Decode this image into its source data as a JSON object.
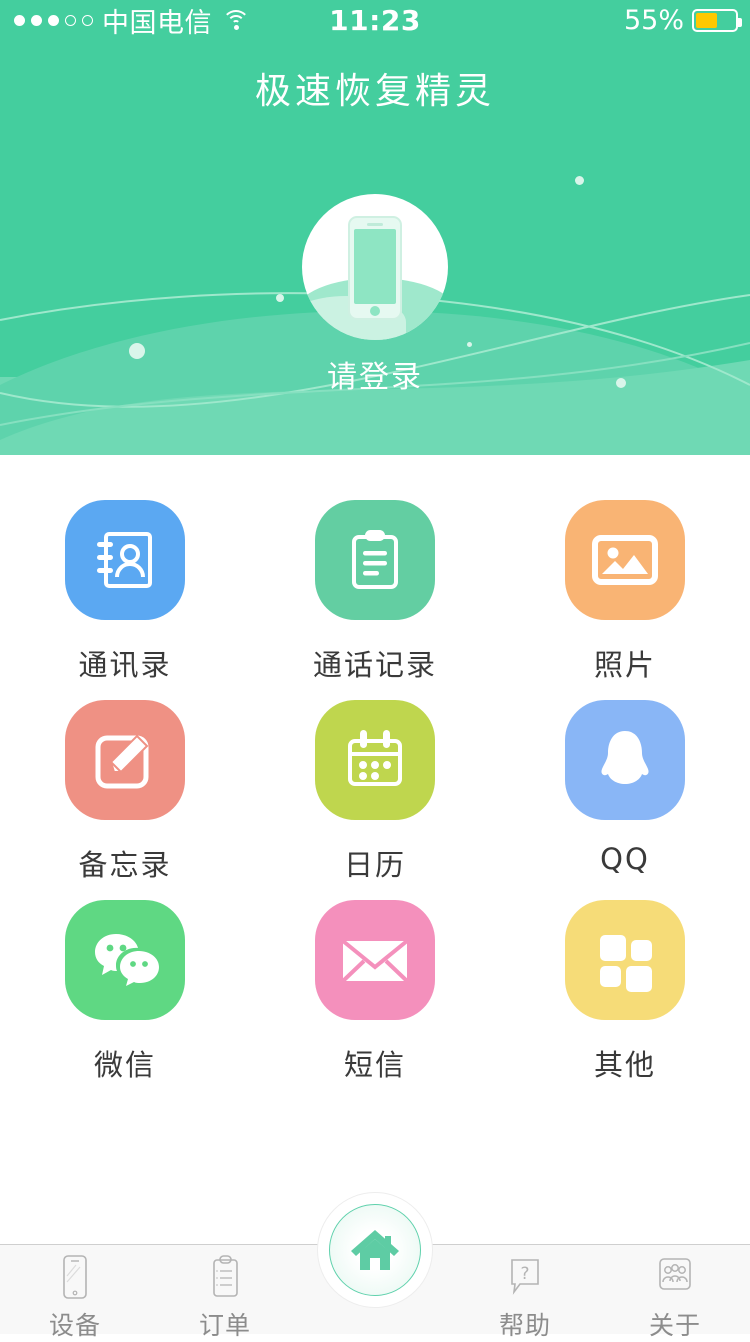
{
  "status_bar": {
    "signal_dots_total": 5,
    "signal_dots_filled": 3,
    "carrier": "中国电信",
    "wifi_icon": "wifi-icon",
    "time": "11:23",
    "battery_percent_label": "55%",
    "battery_level": 55,
    "battery_color": "#FFC800"
  },
  "header": {
    "app_title": "极速恢复精灵",
    "login_label": "请登录",
    "background_color": "#44CE9E",
    "band_color": "#6FD9B4",
    "avatar_icon": "phone-avatar-icon"
  },
  "grid": {
    "items": [
      {
        "label": "通讯录",
        "icon": "contacts-icon",
        "color": "#5BA8F2"
      },
      {
        "label": "通话记录",
        "icon": "clipboard-icon",
        "color": "#63CEA2"
      },
      {
        "label": "照片",
        "icon": "photo-icon",
        "color": "#F9B474"
      },
      {
        "label": "备忘录",
        "icon": "notes-icon",
        "color": "#EF9184"
      },
      {
        "label": "日历",
        "icon": "calendar-icon",
        "color": "#BDD койка"
      },
      {
        "label": "QQ",
        "icon": "qq-icon",
        "color": "#89B6F6"
      },
      {
        "label": "微信",
        "icon": "wechat-icon",
        "color": "#5FD883"
      },
      {
        "label": "短信",
        "icon": "envelope-icon",
        "color": "#F490BC"
      },
      {
        "label": "其他",
        "icon": "grid-icon",
        "color": "#F6DC78"
      }
    ]
  },
  "tabbar": {
    "items": [
      {
        "label": "设备",
        "icon": "phone-outline-icon"
      },
      {
        "label": "订单",
        "icon": "clipboard-outline-icon"
      },
      {
        "label": "帮助",
        "icon": "question-bubble-icon"
      },
      {
        "label": "关于",
        "icon": "people-square-icon"
      }
    ],
    "home_button": {
      "icon": "home-icon",
      "color": "#5FD1AC"
    }
  }
}
